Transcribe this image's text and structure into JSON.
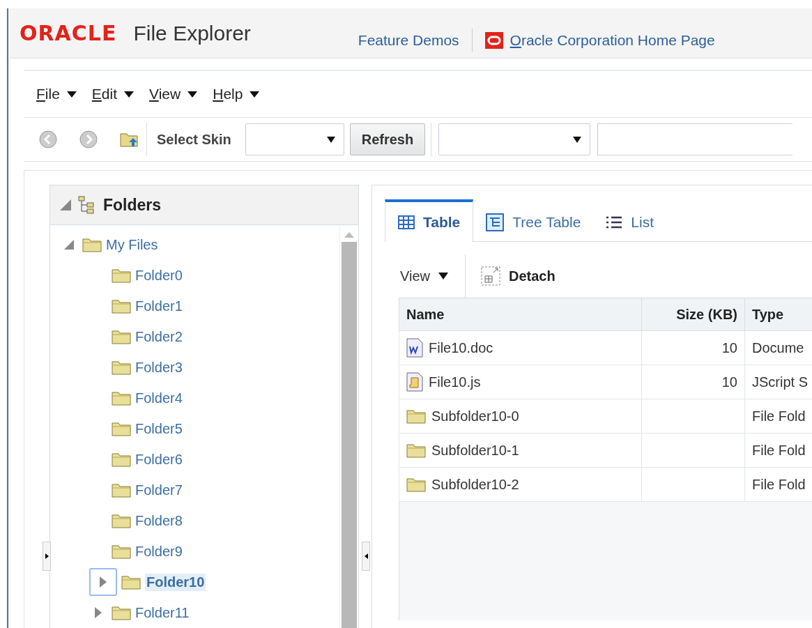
{
  "header": {
    "logo": "ORACLE",
    "title": "File Explorer",
    "links": [
      {
        "label": "Feature Demos",
        "kind": "plain"
      },
      {
        "label": "Oracle Corporation Home Page",
        "kind": "brand"
      }
    ]
  },
  "menus": [
    "File",
    "Edit",
    "View",
    "Help"
  ],
  "toolbar": {
    "skin_label": "Select Skin",
    "refresh": "Refresh"
  },
  "folders": {
    "title": "Folders",
    "expanded": true,
    "tree": [
      {
        "label": "My Files",
        "kind": "branch",
        "expanded": true,
        "selected": false,
        "children": [
          {
            "label": "Folder0",
            "kind": "leaf",
            "selected": false
          },
          {
            "label": "Folder1",
            "kind": "leaf",
            "selected": false
          },
          {
            "label": "Folder2",
            "kind": "leaf",
            "selected": false
          },
          {
            "label": "Folder3",
            "kind": "leaf",
            "selected": false
          },
          {
            "label": "Folder4",
            "kind": "leaf",
            "selected": false
          },
          {
            "label": "Folder5",
            "kind": "leaf",
            "selected": false
          },
          {
            "label": "Folder6",
            "kind": "leaf",
            "selected": false
          },
          {
            "label": "Folder7",
            "kind": "leaf",
            "selected": false
          },
          {
            "label": "Folder8",
            "kind": "leaf",
            "selected": false
          },
          {
            "label": "Folder9",
            "kind": "leaf",
            "selected": false
          },
          {
            "label": "Folder10",
            "kind": "branch",
            "expanded": false,
            "selected": true
          },
          {
            "label": "Folder11",
            "kind": "branch",
            "expanded": false,
            "selected": false
          }
        ]
      }
    ]
  },
  "tabs": [
    {
      "label": "Table",
      "kind": "table",
      "selected": true
    },
    {
      "label": "Tree Table",
      "kind": "treetable",
      "selected": false
    },
    {
      "label": "List",
      "kind": "list",
      "selected": false
    }
  ],
  "table_toolbar": {
    "view": "View",
    "detach": "Detach"
  },
  "table": {
    "columns": [
      "Name",
      "Size (KB)",
      "Type"
    ],
    "rows": [
      {
        "kind": "doc",
        "name": "File10.doc",
        "size": "10",
        "type": "Docume"
      },
      {
        "kind": "script",
        "name": "File10.js",
        "size": "10",
        "type": "JScript S"
      },
      {
        "kind": "folder",
        "name": "Subfolder10-0",
        "type": "File Fold"
      },
      {
        "kind": "folder",
        "name": "Subfolder10-1",
        "type": "File Fold"
      },
      {
        "kind": "folder",
        "name": "Subfolder10-2",
        "type": "File Fold"
      }
    ]
  }
}
